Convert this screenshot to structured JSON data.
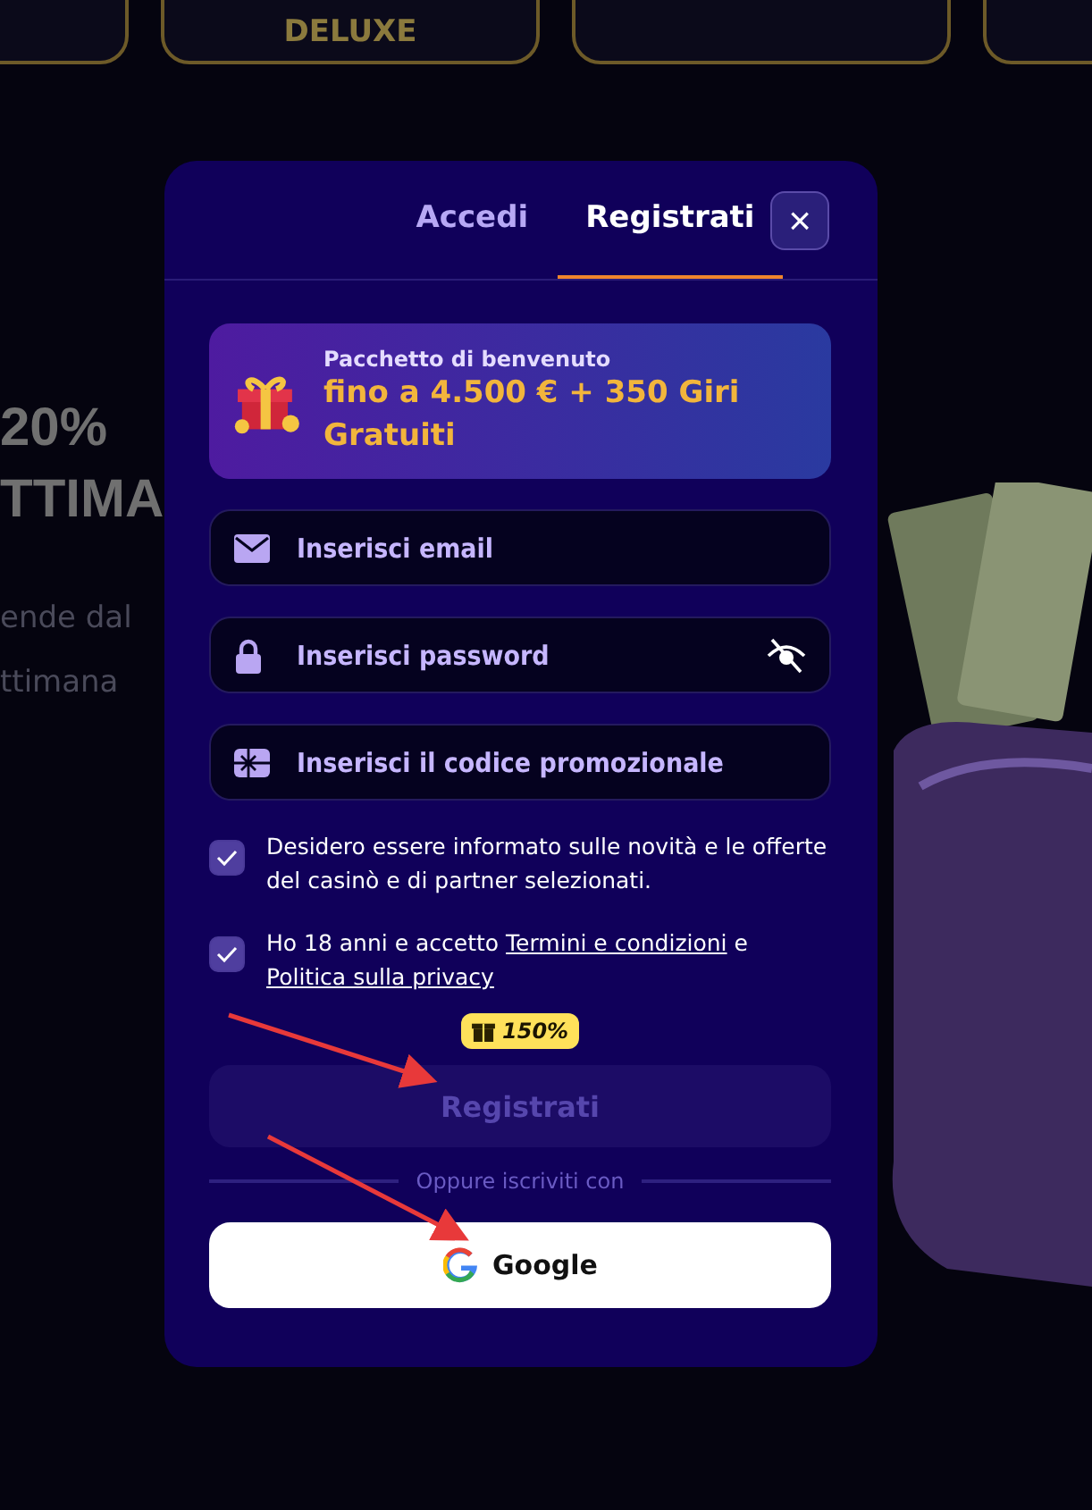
{
  "background": {
    "top_buttons": [
      {
        "kind": "cut"
      },
      {
        "kind": "labeled",
        "label": "DELUXE"
      },
      {
        "kind": "cut"
      },
      {
        "kind": "cut"
      }
    ],
    "promo_texts": [
      {
        "kind": "headline",
        "text": "20%"
      },
      {
        "kind": "headline",
        "text": "TTIMA"
      },
      {
        "kind": "body",
        "text": "ende dal"
      },
      {
        "kind": "body",
        "text": "ttimana"
      }
    ]
  },
  "modal": {
    "tabs": [
      {
        "label": "Accedi",
        "selected": false
      },
      {
        "label": "Registrati",
        "selected": true
      }
    ],
    "close_label": "×",
    "promo": {
      "caption": "Pacchetto di benvenuto",
      "offer": "fino a 4.500 € + 350 Giri Gratuiti"
    },
    "fields": [
      {
        "kind": "email",
        "placeholder": "Inserisci email"
      },
      {
        "kind": "password",
        "placeholder": "Inserisci password"
      },
      {
        "kind": "promo",
        "placeholder": "Inserisci il codice promozionale"
      }
    ],
    "consents": [
      {
        "checked": true,
        "segments": [
          {
            "kind": "text",
            "text": "Desidero essere informato sulle novità e le offerte del casinò e di partner selezionati."
          }
        ]
      },
      {
        "checked": true,
        "segments": [
          {
            "kind": "text",
            "text": "Ho 18 anni e accetto "
          },
          {
            "kind": "link",
            "text": "Termini e condizioni"
          },
          {
            "kind": "text",
            "text": " e "
          },
          {
            "kind": "link",
            "text": "Politica sulla privacy"
          }
        ]
      }
    ],
    "bonus_badge": "150%",
    "submit": {
      "label": "Registrati",
      "disabled": true
    },
    "divider": "Oppure iscriviti con",
    "social": [
      {
        "label": "Google"
      }
    ]
  }
}
